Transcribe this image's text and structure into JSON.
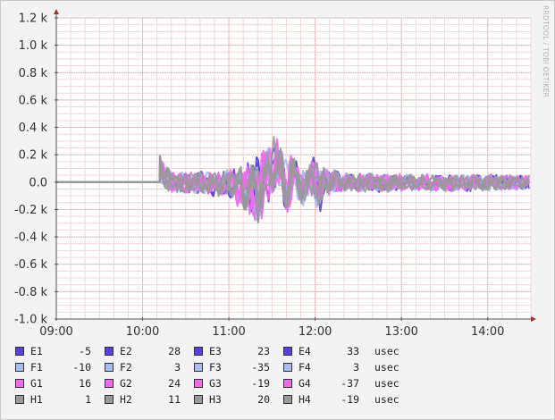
{
  "watermark": "RRDTOOL / TOBI OETIKER",
  "chart_data": {
    "type": "line",
    "title": "",
    "xlabel": "",
    "ylabel": "",
    "x_ticks": [
      "09:00",
      "10:00",
      "11:00",
      "12:00",
      "13:00",
      "14:00"
    ],
    "y_ticks": [
      "1.2 k",
      "1.0 k",
      "0.8 k",
      "0.6 k",
      "0.4 k",
      "0.2 k",
      "0.0",
      "-0.2 k",
      "-0.4 k",
      "-0.6 k",
      "-0.8 k",
      "-1.0 k"
    ],
    "ylim": [
      -1000,
      1200
    ],
    "xlim": [
      "09:00",
      "14:30"
    ],
    "grid": true,
    "unit": "usec",
    "series_colors": {
      "E": "#5a3ee0",
      "F": "#a7bdee",
      "G": "#f06af0",
      "H": "#999999"
    },
    "series": [
      {
        "name": "E1",
        "group": "E",
        "last": "-5"
      },
      {
        "name": "E2",
        "group": "E",
        "last": "28"
      },
      {
        "name": "E3",
        "group": "E",
        "last": "23"
      },
      {
        "name": "E4",
        "group": "E",
        "last": "33"
      },
      {
        "name": "F1",
        "group": "F",
        "last": "-10"
      },
      {
        "name": "F2",
        "group": "F",
        "last": "3"
      },
      {
        "name": "F3",
        "group": "F",
        "last": "-35"
      },
      {
        "name": "F4",
        "group": "F",
        "last": "3"
      },
      {
        "name": "G1",
        "group": "G",
        "last": "16"
      },
      {
        "name": "G2",
        "group": "G",
        "last": "24"
      },
      {
        "name": "G3",
        "group": "G",
        "last": "-19"
      },
      {
        "name": "G4",
        "group": "G",
        "last": "-37"
      },
      {
        "name": "H1",
        "group": "H",
        "last": "1"
      },
      {
        "name": "H2",
        "group": "H",
        "last": "11"
      },
      {
        "name": "H3",
        "group": "H",
        "last": "20"
      },
      {
        "name": "H4",
        "group": "H",
        "last": "-19"
      }
    ],
    "envelope_x": [
      "10:12",
      "10:15",
      "10:20",
      "10:30",
      "10:45",
      "11:00",
      "11:10",
      "11:15",
      "11:20",
      "11:27",
      "11:32",
      "11:36",
      "11:40",
      "11:44",
      "11:48",
      "11:52",
      "11:56",
      "12:00",
      "12:03",
      "12:06",
      "12:10",
      "12:15",
      "12:20",
      "12:40",
      "13:00",
      "13:30",
      "14:00",
      "14:30"
    ],
    "envelope_max": [
      250,
      150,
      110,
      90,
      100,
      110,
      170,
      200,
      250,
      300,
      380,
      320,
      200,
      250,
      150,
      150,
      140,
      250,
      120,
      150,
      100,
      110,
      80,
      80,
      70,
      70,
      70,
      60
    ],
    "envelope_min": [
      0,
      -80,
      -90,
      -100,
      -120,
      -130,
      -250,
      -300,
      -380,
      -200,
      -120,
      -200,
      -280,
      -150,
      -150,
      -200,
      -100,
      -160,
      -300,
      -100,
      -120,
      -90,
      -80,
      -90,
      -80,
      -80,
      -80,
      -60
    ]
  }
}
